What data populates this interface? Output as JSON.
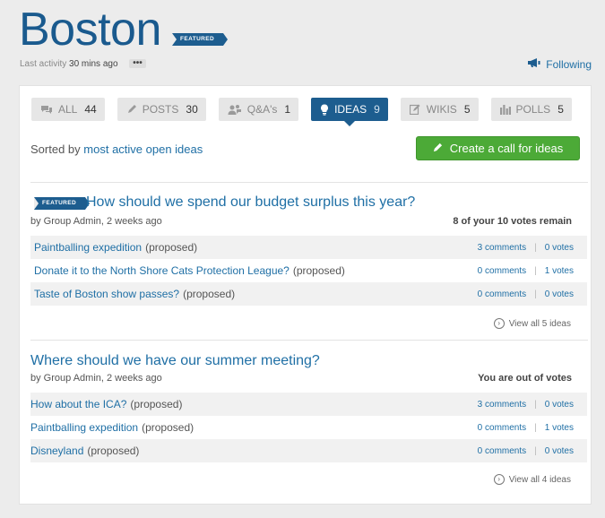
{
  "group": {
    "title": "Boston",
    "featured_label": "FEATURED",
    "last_activity_label": "Last activity",
    "last_activity_value": "30 mins ago",
    "more_label": "•••",
    "following_label": "Following"
  },
  "tabs": [
    {
      "label": "ALL",
      "count": "44",
      "icon": "speech-bubbles-icon"
    },
    {
      "label": "POSTS",
      "count": "30",
      "icon": "pencil-icon"
    },
    {
      "label": "Q&A's",
      "count": "1",
      "icon": "qa-people-icon"
    },
    {
      "label": "IDEAS",
      "count": "9",
      "icon": "lightbulb-icon",
      "active": true
    },
    {
      "label": "WIKIS",
      "count": "5",
      "icon": "wiki-edit-icon"
    },
    {
      "label": "POLLS",
      "count": "5",
      "icon": "bar-chart-icon"
    }
  ],
  "sort": {
    "prefix": "Sorted by",
    "value": "most active open ideas"
  },
  "create_button_label": "Create a call for ideas",
  "calls": [
    {
      "featured_label": "FEATURED",
      "title": "How should we spend our budget surplus this year?",
      "meta": "by Group Admin, 2 weeks ago",
      "votes_status": "8 of your 10 votes remain",
      "ideas": [
        {
          "name": "Paintballing expedition",
          "status": "(proposed)",
          "comments": "3 comments",
          "votes": "0 votes"
        },
        {
          "name": "Donate it to the North Shore Cats Protection League?",
          "status": "(proposed)",
          "comments": "0 comments",
          "votes": "1 votes"
        },
        {
          "name": "Taste of Boston show passes?",
          "status": "(proposed)",
          "comments": "0 comments",
          "votes": "0 votes"
        }
      ],
      "view_all_label": "View all 5 ideas"
    },
    {
      "title": "Where should we have our summer meeting?",
      "meta": "by Group Admin, 2 weeks ago",
      "votes_status": "You are out of votes",
      "ideas": [
        {
          "name": "How about the ICA?",
          "status": "(proposed)",
          "comments": "3 comments",
          "votes": "0 votes"
        },
        {
          "name": "Paintballing expedition",
          "status": "(proposed)",
          "comments": "0 comments",
          "votes": "1 votes"
        },
        {
          "name": "Disneyland",
          "status": "(proposed)",
          "comments": "0 comments",
          "votes": "0 votes"
        }
      ],
      "view_all_label": "View all 4 ideas"
    }
  ],
  "colors": {
    "brand_blue": "#1d5d8f",
    "link_blue": "#1f6fa5",
    "create_green": "#4caa37"
  }
}
